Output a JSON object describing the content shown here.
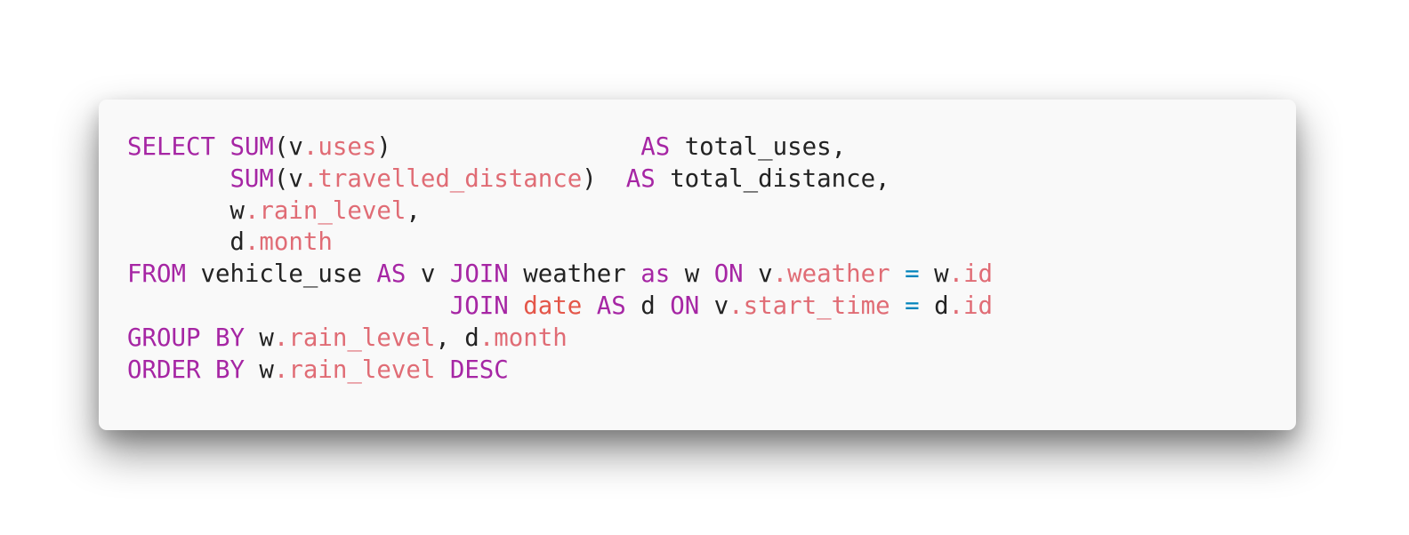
{
  "code": {
    "language": "sql",
    "lines": [
      [
        {
          "t": "SELECT",
          "c": "kw"
        },
        {
          "t": " ",
          "c": "plain"
        },
        {
          "t": "SUM",
          "c": "fn"
        },
        {
          "t": "(v",
          "c": "plain"
        },
        {
          "t": ".uses",
          "c": "prop"
        },
        {
          "t": ")                 ",
          "c": "plain"
        },
        {
          "t": "AS",
          "c": "kw"
        },
        {
          "t": " total_uses,",
          "c": "plain"
        }
      ],
      [
        {
          "t": "       ",
          "c": "plain"
        },
        {
          "t": "SUM",
          "c": "fn"
        },
        {
          "t": "(v",
          "c": "plain"
        },
        {
          "t": ".travelled_distance",
          "c": "prop"
        },
        {
          "t": ")  ",
          "c": "plain"
        },
        {
          "t": "AS",
          "c": "kw"
        },
        {
          "t": " total_distance,",
          "c": "plain"
        }
      ],
      [
        {
          "t": "       w",
          "c": "plain"
        },
        {
          "t": ".rain_level",
          "c": "prop"
        },
        {
          "t": ",",
          "c": "plain"
        }
      ],
      [
        {
          "t": "       d",
          "c": "plain"
        },
        {
          "t": ".month",
          "c": "prop"
        }
      ],
      [
        {
          "t": "FROM",
          "c": "kw"
        },
        {
          "t": " vehicle_use ",
          "c": "plain"
        },
        {
          "t": "AS",
          "c": "kw"
        },
        {
          "t": " v ",
          "c": "plain"
        },
        {
          "t": "JOIN",
          "c": "kw"
        },
        {
          "t": " weather ",
          "c": "plain"
        },
        {
          "t": "as",
          "c": "kw"
        },
        {
          "t": " w ",
          "c": "plain"
        },
        {
          "t": "ON",
          "c": "kw"
        },
        {
          "t": " v",
          "c": "plain"
        },
        {
          "t": ".weather",
          "c": "prop"
        },
        {
          "t": " ",
          "c": "plain"
        },
        {
          "t": "=",
          "c": "op"
        },
        {
          "t": " w",
          "c": "plain"
        },
        {
          "t": ".id",
          "c": "prop"
        }
      ],
      [
        {
          "t": "                      ",
          "c": "plain"
        },
        {
          "t": "JOIN",
          "c": "kw"
        },
        {
          "t": " ",
          "c": "plain"
        },
        {
          "t": "date",
          "c": "tbl"
        },
        {
          "t": " ",
          "c": "plain"
        },
        {
          "t": "AS",
          "c": "kw"
        },
        {
          "t": " d ",
          "c": "plain"
        },
        {
          "t": "ON",
          "c": "kw"
        },
        {
          "t": " v",
          "c": "plain"
        },
        {
          "t": ".start_time",
          "c": "prop"
        },
        {
          "t": " ",
          "c": "plain"
        },
        {
          "t": "=",
          "c": "op"
        },
        {
          "t": " d",
          "c": "plain"
        },
        {
          "t": ".id",
          "c": "prop"
        }
      ],
      [
        {
          "t": "GROUP",
          "c": "kw"
        },
        {
          "t": " ",
          "c": "plain"
        },
        {
          "t": "BY",
          "c": "kw"
        },
        {
          "t": " w",
          "c": "plain"
        },
        {
          "t": ".rain_level",
          "c": "prop"
        },
        {
          "t": ", d",
          "c": "plain"
        },
        {
          "t": ".month",
          "c": "prop"
        }
      ],
      [
        {
          "t": "ORDER",
          "c": "kw"
        },
        {
          "t": " ",
          "c": "plain"
        },
        {
          "t": "BY",
          "c": "kw"
        },
        {
          "t": " w",
          "c": "plain"
        },
        {
          "t": ".rain_level",
          "c": "prop"
        },
        {
          "t": " ",
          "c": "plain"
        },
        {
          "t": "DESC",
          "c": "kw"
        }
      ]
    ]
  },
  "colors": {
    "keyword": "#a626a4",
    "property": "#e06c75",
    "operator": "#0184bc",
    "table": "#e45649",
    "text": "#232323",
    "background": "#f9f9f9"
  }
}
